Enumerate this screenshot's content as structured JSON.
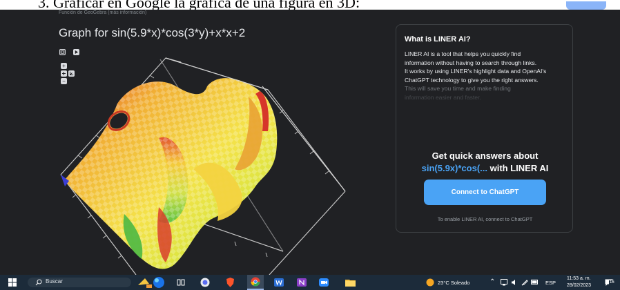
{
  "document": {
    "caption": "3. Graficar en Google la grafica de una figura en 3D:"
  },
  "graph": {
    "source_line": "Función de GeoGebra (más información)",
    "title": "Graph for sin(5.9*x)*cos(3*y)+x*x+2"
  },
  "controls": {
    "zoom_in": "+",
    "zoom_out": "−"
  },
  "liner": {
    "heading": "What is LINER AI?",
    "body": [
      "LINER AI is a tool that helps you quickly find information without having to search through links.",
      "It works by using LINER's highlight data and OpenAI's ChatGPT technology to give you the right answers."
    ],
    "body_faded": "This will save you time and make finding",
    "body_faded2": "information easier and faster.",
    "quick_line1": "Get quick answers about",
    "quick_query": "sin(5.9x)*cos(...",
    "quick_suffix": " with LINER AI",
    "connect_button": "Connect to ChatGPT",
    "enable_text": "To enable LINER AI, connect to ChatGPT"
  },
  "taskbar": {
    "search_placeholder": "Buscar",
    "weather": "23°C  Soleado",
    "language": "ESP",
    "time": "11:53 a. m.",
    "date": "28/02/2023",
    "notification_count": "16"
  },
  "colors": {
    "background": "#202124",
    "accent": "#4aa3f5",
    "taskbar": "#1c2b3a"
  }
}
